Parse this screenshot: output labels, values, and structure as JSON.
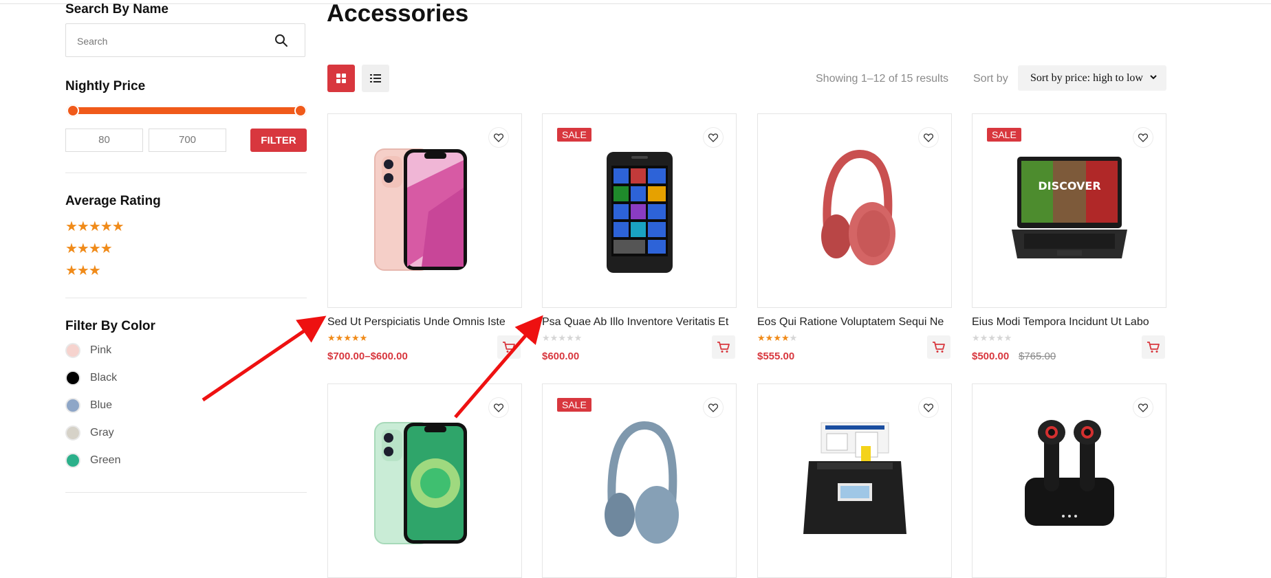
{
  "sidebar": {
    "search": {
      "title": "Search By Name",
      "placeholder": "Search"
    },
    "price": {
      "title": "Nightly Price",
      "min": "80",
      "max": "700",
      "filter_label": "FILTER"
    },
    "rating": {
      "title": "Average Rating",
      "options": [
        "★★★★★",
        "★★★★",
        "★★★"
      ]
    },
    "color": {
      "title": "Filter By Color",
      "items": [
        {
          "label": "Pink",
          "hex": "#f6d3ce"
        },
        {
          "label": "Black",
          "hex": "#000000"
        },
        {
          "label": "Blue",
          "hex": "#8ea6c7"
        },
        {
          "label": "Gray",
          "hex": "#d6d2c8"
        },
        {
          "label": "Green",
          "hex": "#2bb08a"
        }
      ]
    }
  },
  "main": {
    "title": "Accessories",
    "result_count": "Showing 1–12 of 15 results",
    "sort_label": "Sort by",
    "sort_value": "Sort by price: high to low",
    "products": [
      {
        "name": "Sed Ut Perspiciatis Unde Omnis Iste",
        "rating": 5,
        "price": "$700.00–$600.00",
        "old_price": "",
        "sale": false,
        "image": "pink-phone"
      },
      {
        "name": "Psa Quae Ab Illo Inventore Veritatis Et",
        "rating": 0,
        "price": "$600.00",
        "old_price": "",
        "sale": true,
        "image": "black-windows-phone"
      },
      {
        "name": "Eos Qui Ratione Voluptatem Sequi Ne",
        "rating": 4,
        "price": "$555.00",
        "old_price": "",
        "sale": false,
        "image": "red-headphones"
      },
      {
        "name": "Eius Modi Tempora Incidunt Ut Labo",
        "rating": 0,
        "price": "$500.00",
        "old_price": "$765.00",
        "sale": true,
        "image": "gaming-laptop"
      },
      {
        "name": "",
        "rating": 0,
        "price": "",
        "old_price": "",
        "sale": false,
        "image": "green-phone"
      },
      {
        "name": "",
        "rating": 0,
        "price": "",
        "old_price": "",
        "sale": true,
        "image": "blue-headphones"
      },
      {
        "name": "",
        "rating": 0,
        "price": "",
        "old_price": "",
        "sale": false,
        "image": "document-scanner"
      },
      {
        "name": "",
        "rating": 0,
        "price": "",
        "old_price": "",
        "sale": false,
        "image": "wireless-earbuds"
      }
    ],
    "sale_label": "SALE"
  },
  "colors": {
    "accent": "#d8373e",
    "slider": "#f05a1a",
    "star": "#f08b1a",
    "arrow": "#ee1111"
  }
}
